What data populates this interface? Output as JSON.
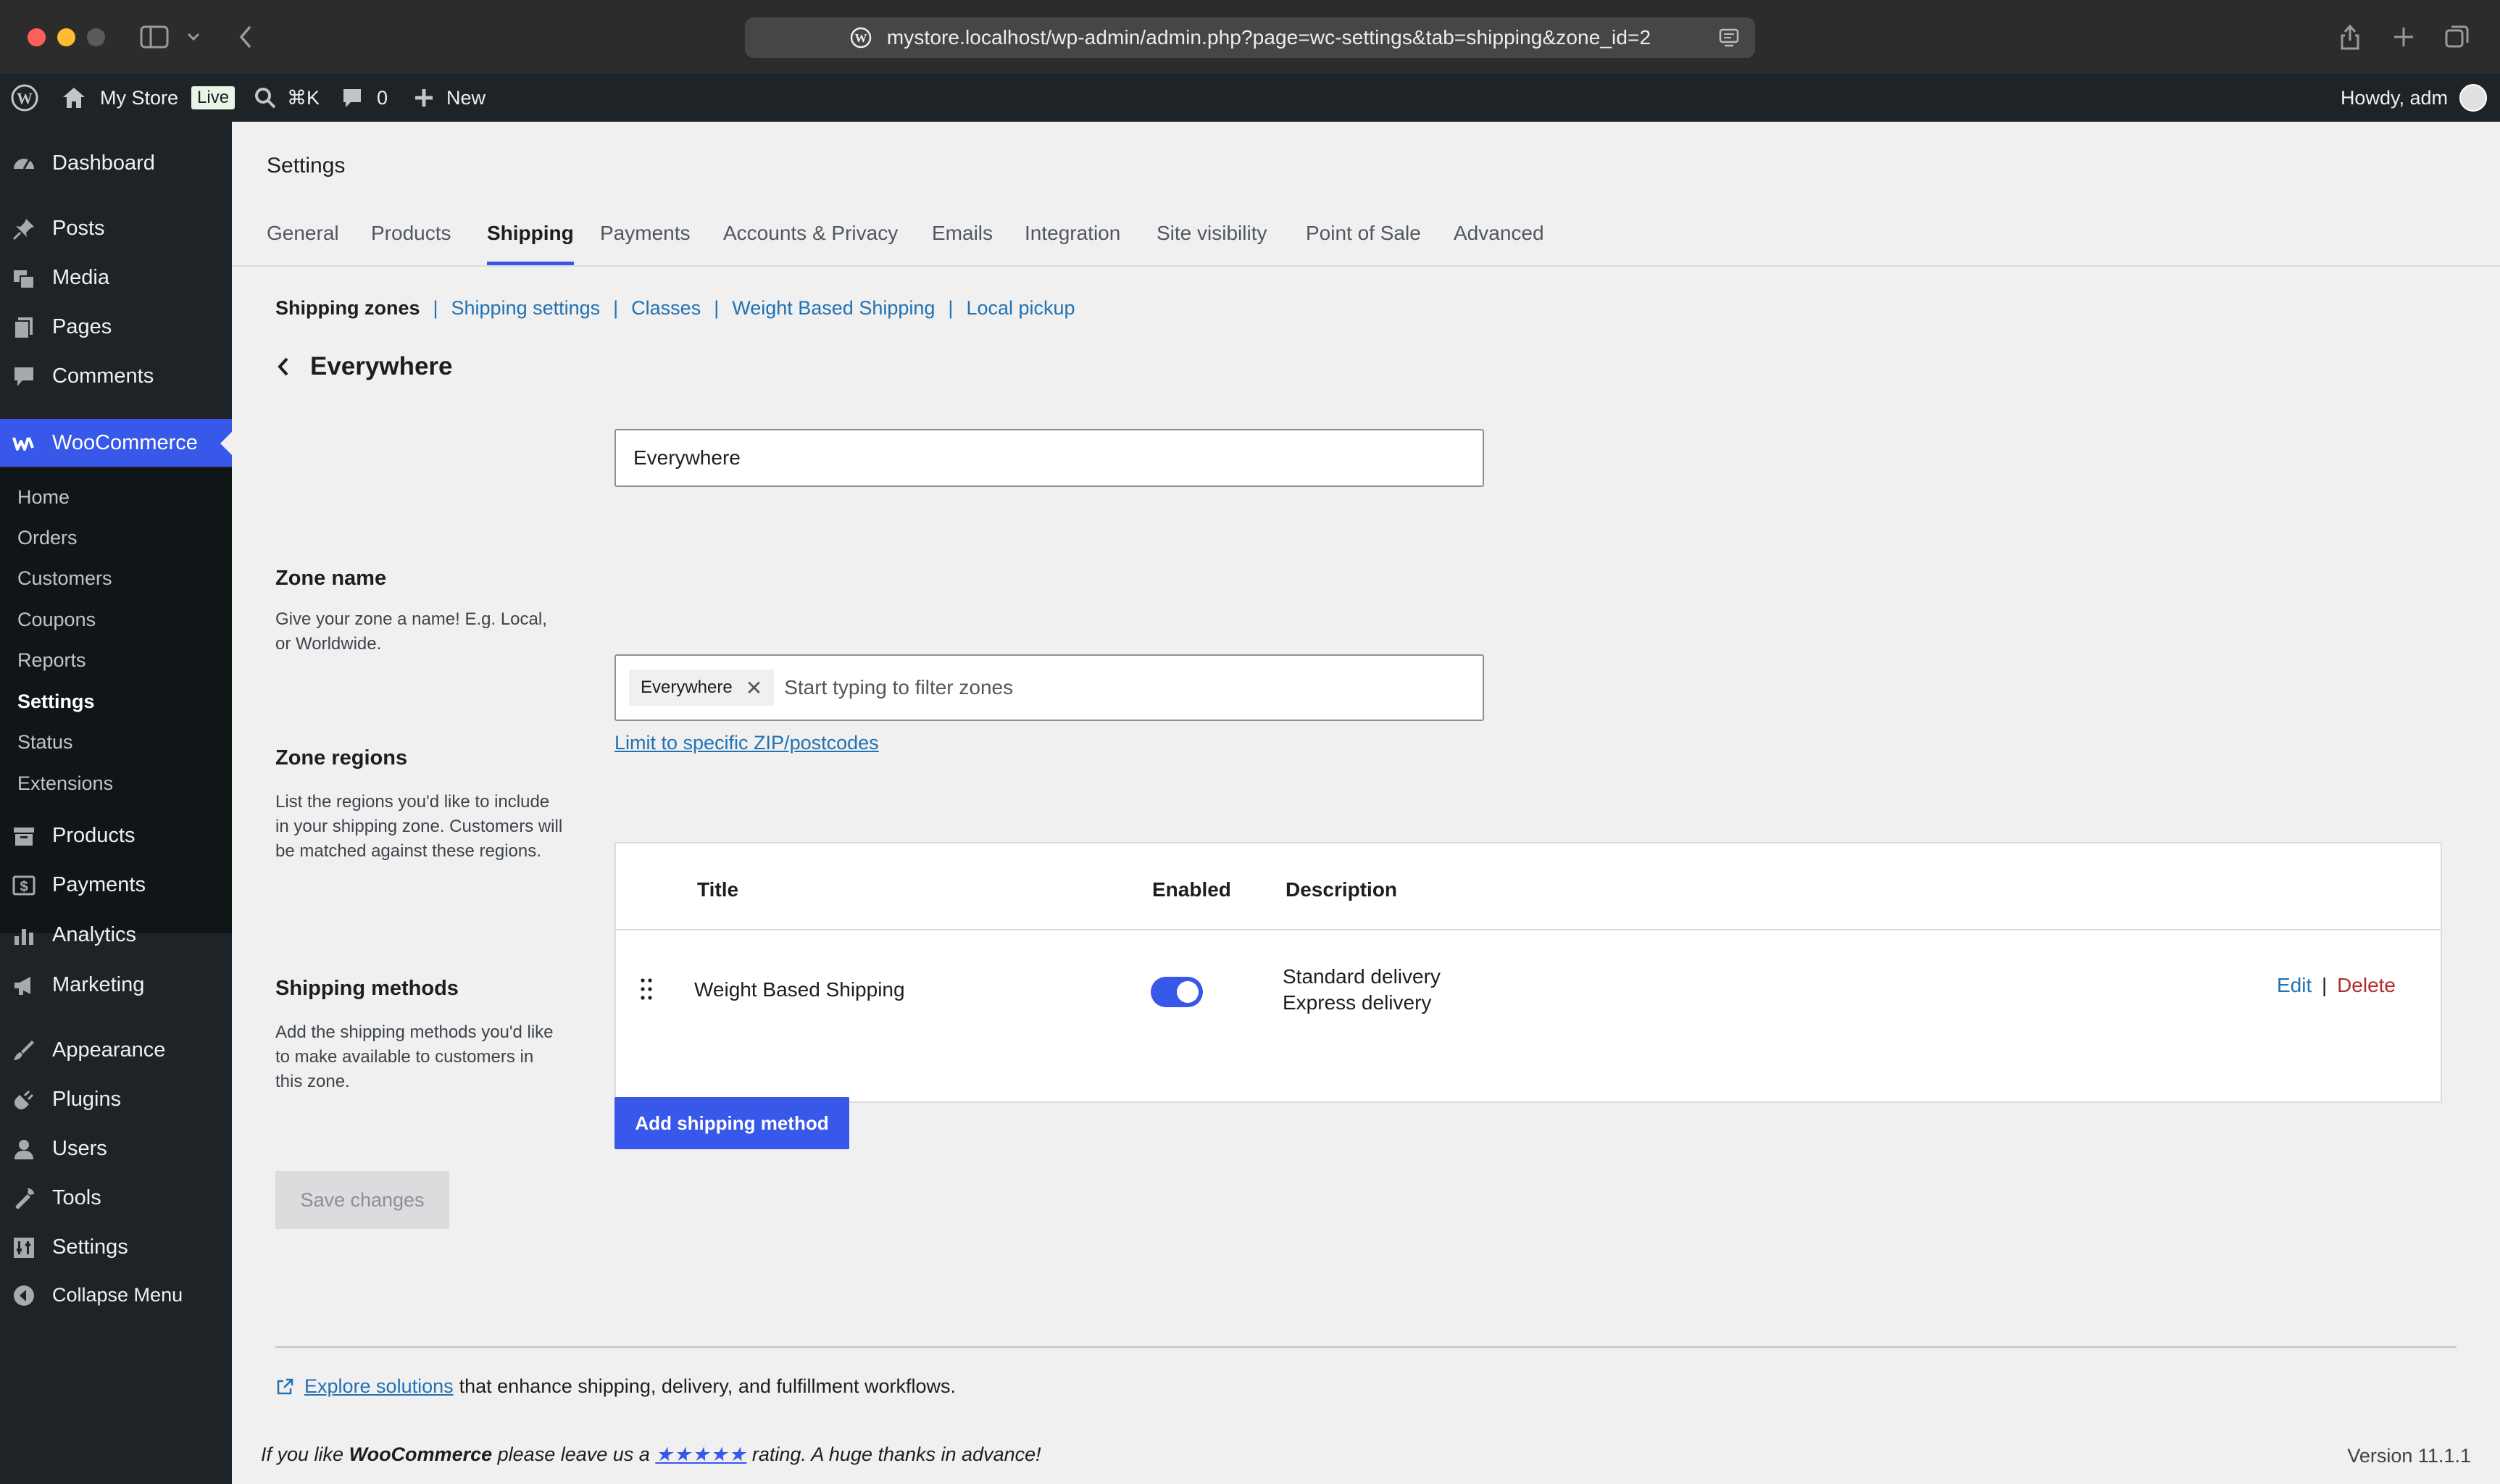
{
  "browser": {
    "url": "mystore.localhost/wp-admin/admin.php?page=wc-settings&tab=shipping&zone_id=2"
  },
  "admin_bar": {
    "site_name": "My Store",
    "live_badge": "Live",
    "search_shortcut": "⌘K",
    "comments_count": "0",
    "new_label": "New",
    "howdy": "Howdy, adm"
  },
  "sidebar": {
    "items": [
      {
        "label": "Dashboard",
        "icon": "dashboard-icon"
      },
      {
        "label": "Posts",
        "icon": "pin-icon"
      },
      {
        "label": "Media",
        "icon": "media-icon"
      },
      {
        "label": "Pages",
        "icon": "pages-icon"
      },
      {
        "label": "Comments",
        "icon": "comment-icon"
      },
      {
        "label": "WooCommerce",
        "icon": "woo-icon"
      },
      {
        "label": "Products",
        "icon": "archive-icon"
      },
      {
        "label": "Payments",
        "icon": "dollar-icon"
      },
      {
        "label": "Analytics",
        "icon": "chart-icon"
      },
      {
        "label": "Marketing",
        "icon": "megaphone-icon"
      },
      {
        "label": "Appearance",
        "icon": "brush-icon"
      },
      {
        "label": "Plugins",
        "icon": "plug-icon"
      },
      {
        "label": "Users",
        "icon": "user-icon"
      },
      {
        "label": "Tools",
        "icon": "wrench-icon"
      },
      {
        "label": "Settings",
        "icon": "settings-icon"
      },
      {
        "label": "Collapse Menu",
        "icon": "collapse-icon"
      }
    ],
    "woo_submenu": [
      "Home",
      "Orders",
      "Customers",
      "Coupons",
      "Reports",
      "Settings",
      "Status",
      "Extensions"
    ],
    "woo_submenu_current": "Settings"
  },
  "page": {
    "title": "Settings",
    "tabs": [
      "General",
      "Products",
      "Shipping",
      "Payments",
      "Accounts & Privacy",
      "Emails",
      "Integration",
      "Site visibility",
      "Point of Sale",
      "Advanced"
    ],
    "active_tab": "Shipping",
    "subsections": {
      "current": "Shipping zones",
      "links": [
        "Shipping settings",
        "Classes",
        "Weight Based Shipping",
        "Local pickup"
      ],
      "separator": "|"
    },
    "zone_heading": "Everywhere"
  },
  "form": {
    "zone_name": {
      "label": "Zone name",
      "help": "Give your zone a name! E.g. Local, or Worldwide.",
      "value": "Everywhere"
    },
    "zone_regions": {
      "label": "Zone regions",
      "help": "List the regions you'd like to include in your shipping zone. Customers will be matched against these regions.",
      "chip": "Everywhere",
      "placeholder": "Start typing to filter zones",
      "limit_link": "Limit to specific ZIP/postcodes"
    },
    "shipping_methods": {
      "label": "Shipping methods",
      "help": "Add the shipping methods you'd like to make available to customers in this zone.",
      "columns": {
        "title": "Title",
        "enabled": "Enabled",
        "description": "Description"
      },
      "rows": [
        {
          "title": "Weight Based Shipping",
          "enabled": true,
          "description": [
            "Standard delivery",
            "Express delivery"
          ],
          "edit": "Edit",
          "separator": "|",
          "delete": "Delete"
        }
      ],
      "add_button": "Add shipping method"
    },
    "save_button": "Save changes"
  },
  "footer": {
    "explore_link": "Explore solutions",
    "explore_text": "that enhance shipping, delivery, and fulfillment workflows.",
    "rating_prefix": "If you like",
    "rating_brand": "WooCommerce",
    "rating_middle": "please leave us a",
    "rating_stars": "★★★★★",
    "rating_suffix": "rating. A huge thanks in advance!",
    "version": "Version 11.1.1"
  },
  "colors": {
    "accent": "#3858e9",
    "link": "#2271b1",
    "delete": "#b32d2e",
    "sidebar_bg": "#1d2327"
  }
}
